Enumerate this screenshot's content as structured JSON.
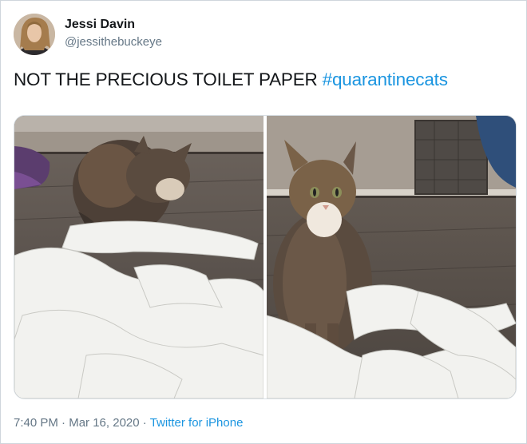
{
  "tweet": {
    "author_name": "Jessi Davin",
    "author_handle": "@jessithebuckeye",
    "text": "NOT THE PRECIOUS TOILET PAPER",
    "hashtag": "#quarantinecats",
    "time": "7:40 PM",
    "separator": "·",
    "date": "Mar 16, 2020",
    "source": "Twitter for iPhone"
  },
  "media": {
    "photos": [
      {
        "description_icon": "cat-toilet-paper-photo"
      },
      {
        "description_icon": "cat-toilet-paper-photo"
      }
    ]
  },
  "colors": {
    "text": "#14171a",
    "secondary": "#657786",
    "link": "#1b95e0",
    "border": "#cfd6dc"
  }
}
